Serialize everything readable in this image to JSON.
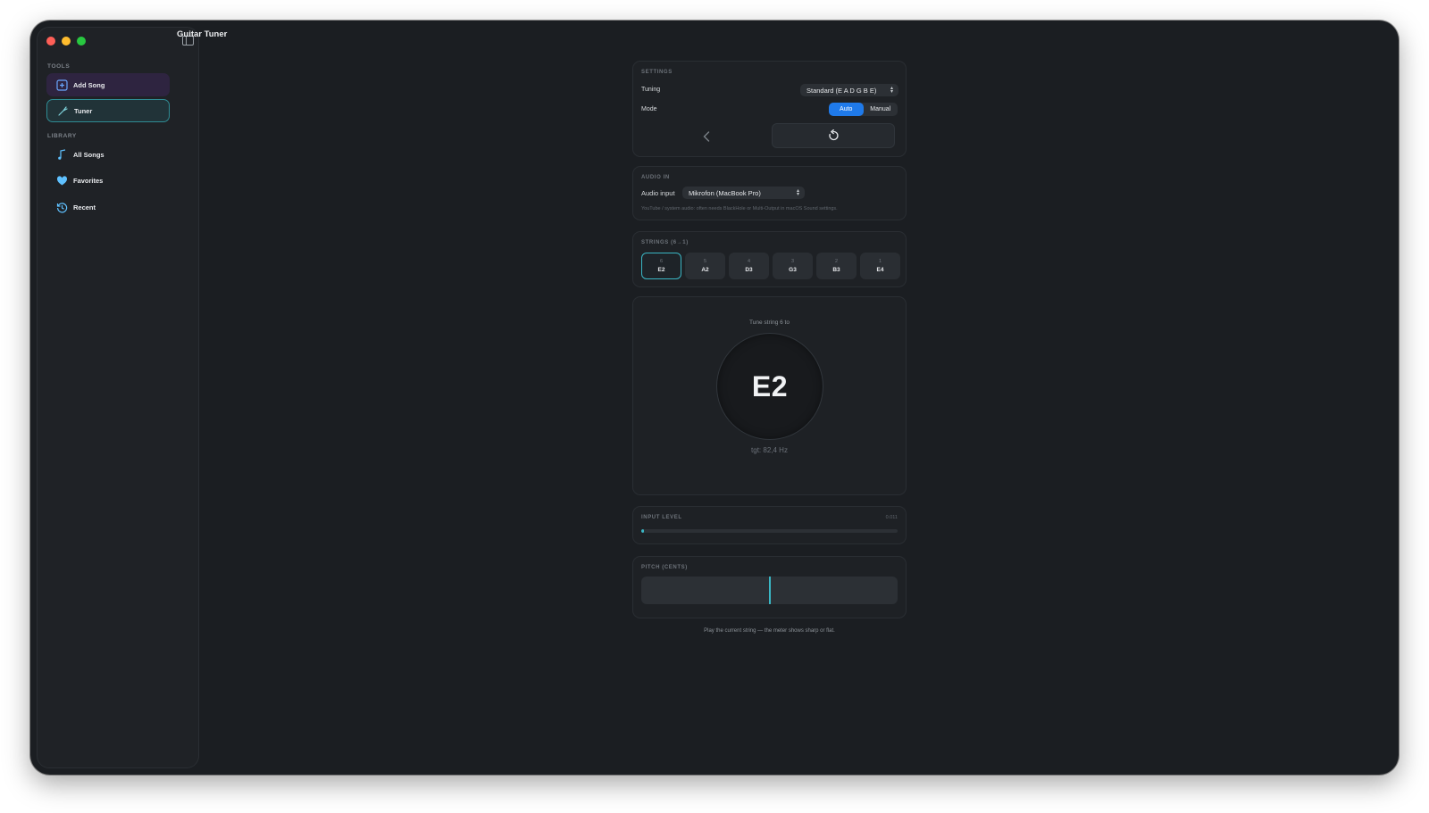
{
  "app": {
    "title": "Guitar Tuner"
  },
  "sidebar": {
    "tools_label": "TOOLS",
    "library_label": "LIBRARY",
    "tools": [
      {
        "label": "Add Song",
        "icon": "plus-square-icon"
      },
      {
        "label": "Tuner",
        "icon": "tuning-fork-icon"
      }
    ],
    "library": [
      {
        "label": "All Songs",
        "icon": "music-note-icon"
      },
      {
        "label": "Favorites",
        "icon": "heart-icon"
      },
      {
        "label": "Recent",
        "icon": "history-icon"
      }
    ]
  },
  "settings": {
    "label": "SETTINGS",
    "tuning_label": "Tuning",
    "tuning_value": "Standard (E A D G B E)",
    "mode_label": "Mode",
    "mode_options": [
      "Auto",
      "Manual"
    ],
    "mode_selected": "Auto"
  },
  "audio": {
    "label": "AUDIO IN",
    "input_label": "Audio input",
    "input_value": "Mikrofon (MacBook Pro)",
    "hint": "YouTube / system audio: often needs BlackHole or Multi-Output in macOS Sound settings."
  },
  "strings": {
    "label": "STRINGS (6→1)",
    "items": [
      {
        "num": "6",
        "note": "E2"
      },
      {
        "num": "5",
        "note": "A2"
      },
      {
        "num": "4",
        "note": "D3"
      },
      {
        "num": "3",
        "note": "G3"
      },
      {
        "num": "2",
        "note": "B3"
      },
      {
        "num": "1",
        "note": "E4"
      }
    ],
    "selected_index": 0
  },
  "tuner": {
    "caption": "Tune string 6 to",
    "note": "E2",
    "target": "tgt: 82,4 Hz"
  },
  "input_level": {
    "label": "INPUT LEVEL",
    "value": "0.011",
    "fraction": 0.011
  },
  "pitch": {
    "label": "PITCH (CENTS)",
    "cents": 0,
    "range": 50
  },
  "footer": "Play the current string — the meter shows sharp or flat.",
  "colors": {
    "accent": "#3ab6c4",
    "primary_blue": "#1f7aea",
    "window_bg": "#1b1e22"
  }
}
